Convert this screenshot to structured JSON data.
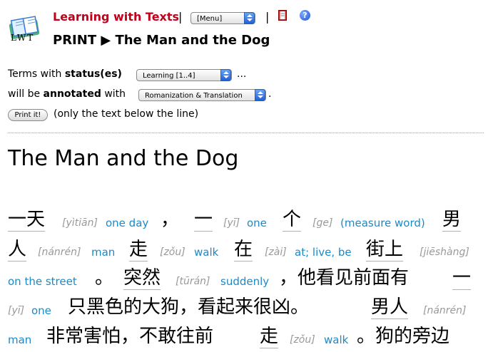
{
  "header": {
    "logo_text": "LWT",
    "app_title": "Learning with Texts",
    "separator": "|",
    "menu_select": "[Menu]",
    "page_title": "PRINT ▶ The Man and the Dog"
  },
  "form": {
    "terms_prefix": "Terms with",
    "status_label": "status(es)",
    "status_select": "Learning [1..4]",
    "ellipsis": "...",
    "will_be": "will be",
    "annotated_label": "annotated",
    "with_label": "with",
    "annotation_select": "Romanization & Translation",
    "period": ".",
    "print_button": "Print it!",
    "print_note": "(only the text below the line)"
  },
  "text": {
    "title": "The Man and the Dog",
    "tokens": [
      {
        "w": "一天",
        "rom": "[yìtiān]",
        "tr": "one day"
      },
      {
        "w": "，"
      },
      {
        "w": "一",
        "rom": "[yī]",
        "tr": "one"
      },
      {
        "w": "个",
        "rom": "[ge]",
        "tr": "(measure word)"
      },
      {
        "w": "男"
      },
      {
        "w": "人",
        "rom": "[nánrén]",
        "tr": "man"
      },
      {
        "w": "走",
        "rom": "[zǒu]",
        "tr": "walk"
      },
      {
        "w": "在",
        "rom": "[zài]",
        "tr": "at; live, be"
      },
      {
        "w": "街上",
        "rom": "[jiēshàng]",
        "tr": "on the street"
      },
      {
        "w": "。"
      },
      {
        "w": "突然",
        "rom": "[tūrán]",
        "tr": "suddenly"
      },
      {
        "w": "，他看见前面有"
      },
      {
        "w": "一"
      },
      {
        "w": "只黑色的大狗，看起来很凶。"
      },
      {
        "w": "男人",
        "rom": "[nánrén]",
        "tr": "man"
      },
      {
        "w": "非常害怕，不敢往前"
      },
      {
        "w": "走",
        "rom": "[zǒu]",
        "tr": "walk"
      },
      {
        "w": "。狗的旁边"
      }
    ]
  },
  "icons": {
    "logo": "lwt-book-logo",
    "book": "red-book-icon",
    "help": "help-icon",
    "print_arrow": "triangle-right"
  },
  "colors": {
    "brand": "#c0001a",
    "translation": "#1a8ac8",
    "romanization": "#999999"
  }
}
